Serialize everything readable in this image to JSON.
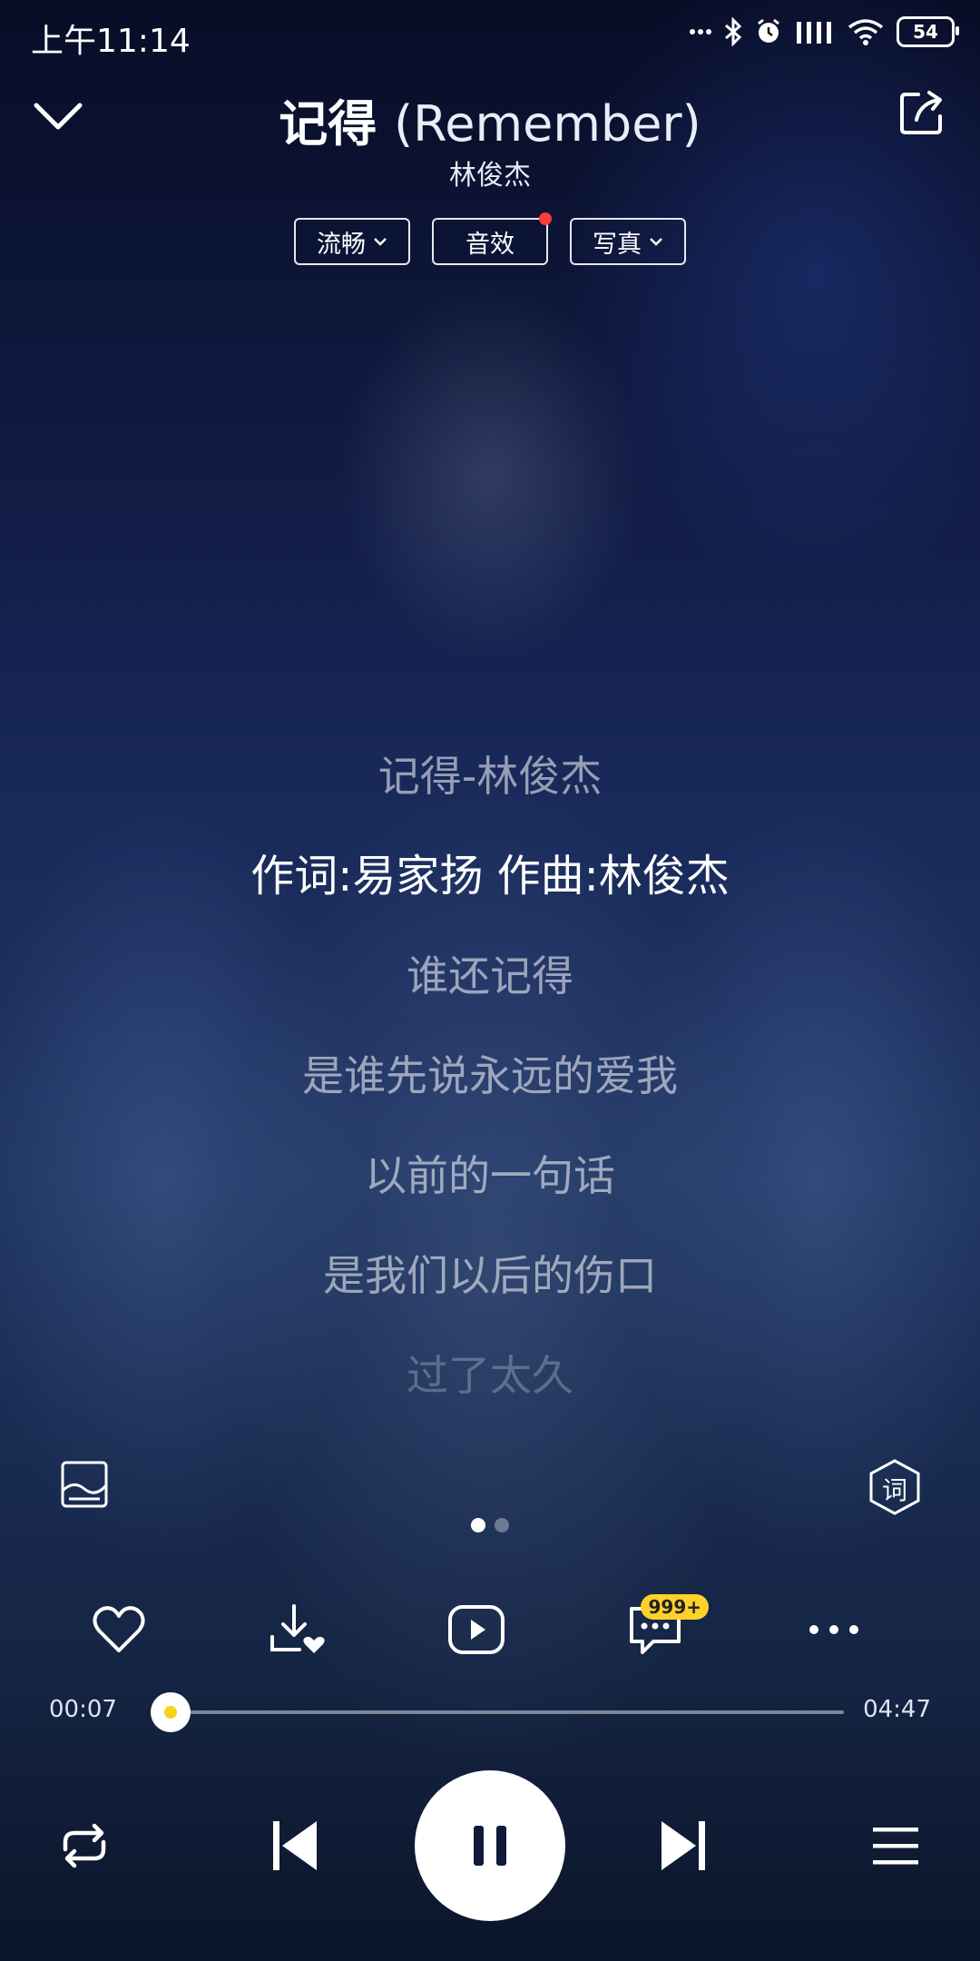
{
  "status_bar": {
    "time": "上午11:14",
    "battery": "54"
  },
  "header": {
    "title": "记得",
    "title_en": "(Remember)",
    "artist": "林俊杰",
    "pills": [
      {
        "label": "流畅",
        "has_dropdown": true,
        "has_dot": false
      },
      {
        "label": "音效",
        "has_dropdown": false,
        "has_dot": true
      },
      {
        "label": "写真",
        "has_dropdown": true,
        "has_dot": false
      }
    ]
  },
  "lyrics": [
    {
      "text": "记得-林俊杰",
      "state": "normal"
    },
    {
      "text": "作词:易家扬 作曲:林俊杰",
      "state": "active"
    },
    {
      "text": "谁还记得",
      "state": "normal"
    },
    {
      "text": "是谁先说永远的爱我",
      "state": "normal"
    },
    {
      "text": "以前的一句话",
      "state": "normal"
    },
    {
      "text": "是我们以后的伤口",
      "state": "normal"
    },
    {
      "text": "过了太久",
      "state": "faded"
    }
  ],
  "side": {
    "right_label": "词"
  },
  "pager": {
    "count": 2,
    "active": 0
  },
  "actions": {
    "comment_badge": "999+"
  },
  "progress": {
    "current": "00:07",
    "total": "04:47",
    "fraction": 0.024
  },
  "colors": {
    "accent_yellow": "#f6d21b",
    "badge_dot": "#ff3b3b"
  },
  "icons": [
    "chevron-down-icon",
    "share-icon",
    "bluetooth-icon",
    "alarm-icon",
    "signal-icon",
    "wifi-icon",
    "battery-icon",
    "image-icon",
    "lyrics-icon",
    "heart-icon",
    "download-icon",
    "video-icon",
    "comment-icon",
    "more-icon",
    "repeat-icon",
    "previous-icon",
    "pause-icon",
    "next-icon",
    "playlist-icon"
  ]
}
